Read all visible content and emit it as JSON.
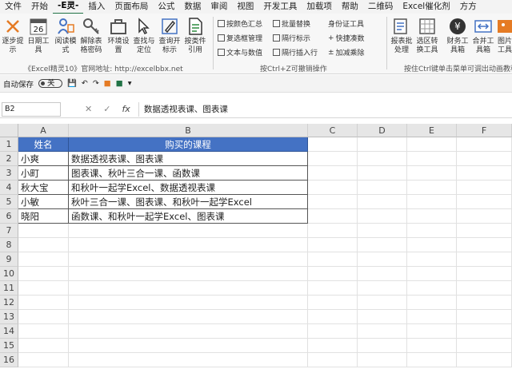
{
  "menu_tabs": [
    "文件",
    "开始",
    "-E灵-",
    "插入",
    "页面布局",
    "公式",
    "数据",
    "审阅",
    "视图",
    "开发工具",
    "加载项",
    "帮助",
    "二维码",
    "Excel催化剂",
    "方方"
  ],
  "active_tab": "-E灵-",
  "ribbon": {
    "buttons": [
      {
        "label": "逐步提示",
        "icon": "close-x-icon"
      },
      {
        "label": "日期工具",
        "icon": "calendar-26-icon"
      },
      {
        "label": "阅读模式",
        "icon": "reading-mode-icon"
      },
      {
        "label": "解除表格密码",
        "icon": "key-icon"
      },
      {
        "label": "环境设置",
        "icon": "toolbox-icon"
      },
      {
        "label": "查找与定位",
        "icon": "cursor-icon"
      },
      {
        "label": "查询开标示",
        "icon": "pen-icon"
      },
      {
        "label": "按类件引用",
        "icon": "document-icon"
      }
    ],
    "small_buttons": [
      "按颜色汇总",
      "复选框管理",
      "文本与数值",
      "批量替换",
      "隔行标示",
      "隔行插入行",
      "身份证工具",
      "快捷凑数",
      "加减乘除"
    ],
    "right_buttons": [
      {
        "label": "报表批处理",
        "icon": "report-icon"
      },
      {
        "label": "选区转换工具",
        "icon": "convert-icon"
      },
      {
        "label": "财务工具箱",
        "icon": "yen-icon"
      },
      {
        "label": "合并工具箱",
        "icon": "merge-icon"
      },
      {
        "label": "图片工具",
        "icon": "image-icon"
      }
    ],
    "group_labels": {
      "left": "《Excel精灵10》官网地址: http://excelbbx.net",
      "middle": "按Ctrl+Z可撤销操作",
      "right": "按住Ctrl键单击菜单可调出动画教程"
    }
  },
  "qat": {
    "autosave": "自动保存",
    "toggle_state": "关"
  },
  "formula_bar": {
    "name_box": "B2",
    "fx": "fx",
    "content": "数据透视表课、图表课"
  },
  "grid": {
    "columns": [
      "A",
      "B",
      "C",
      "D",
      "E",
      "F"
    ],
    "rows": [
      "1",
      "2",
      "3",
      "4",
      "5",
      "6",
      "7",
      "8",
      "9",
      "10",
      "11",
      "12",
      "13",
      "14",
      "15",
      "16"
    ],
    "header_row": {
      "a": "姓名",
      "b": "购买的课程"
    },
    "data_rows": [
      {
        "a": "小爽",
        "b": "数据透视表课、图表课"
      },
      {
        "a": "小町",
        "b": "图表课、秋叶三合一课、函数课"
      },
      {
        "a": "秋大宝",
        "b": "和秋叶一起学Excel、数据透视表课"
      },
      {
        "a": "小敏",
        "b": "秋叶三合一课、图表课、和秋叶一起学Excel"
      },
      {
        "a": "晓阳",
        "b": "函数课、和秋叶一起学Excel、图表课"
      }
    ]
  },
  "colors": {
    "accent": "#217346",
    "table_header": "#4472c4"
  }
}
